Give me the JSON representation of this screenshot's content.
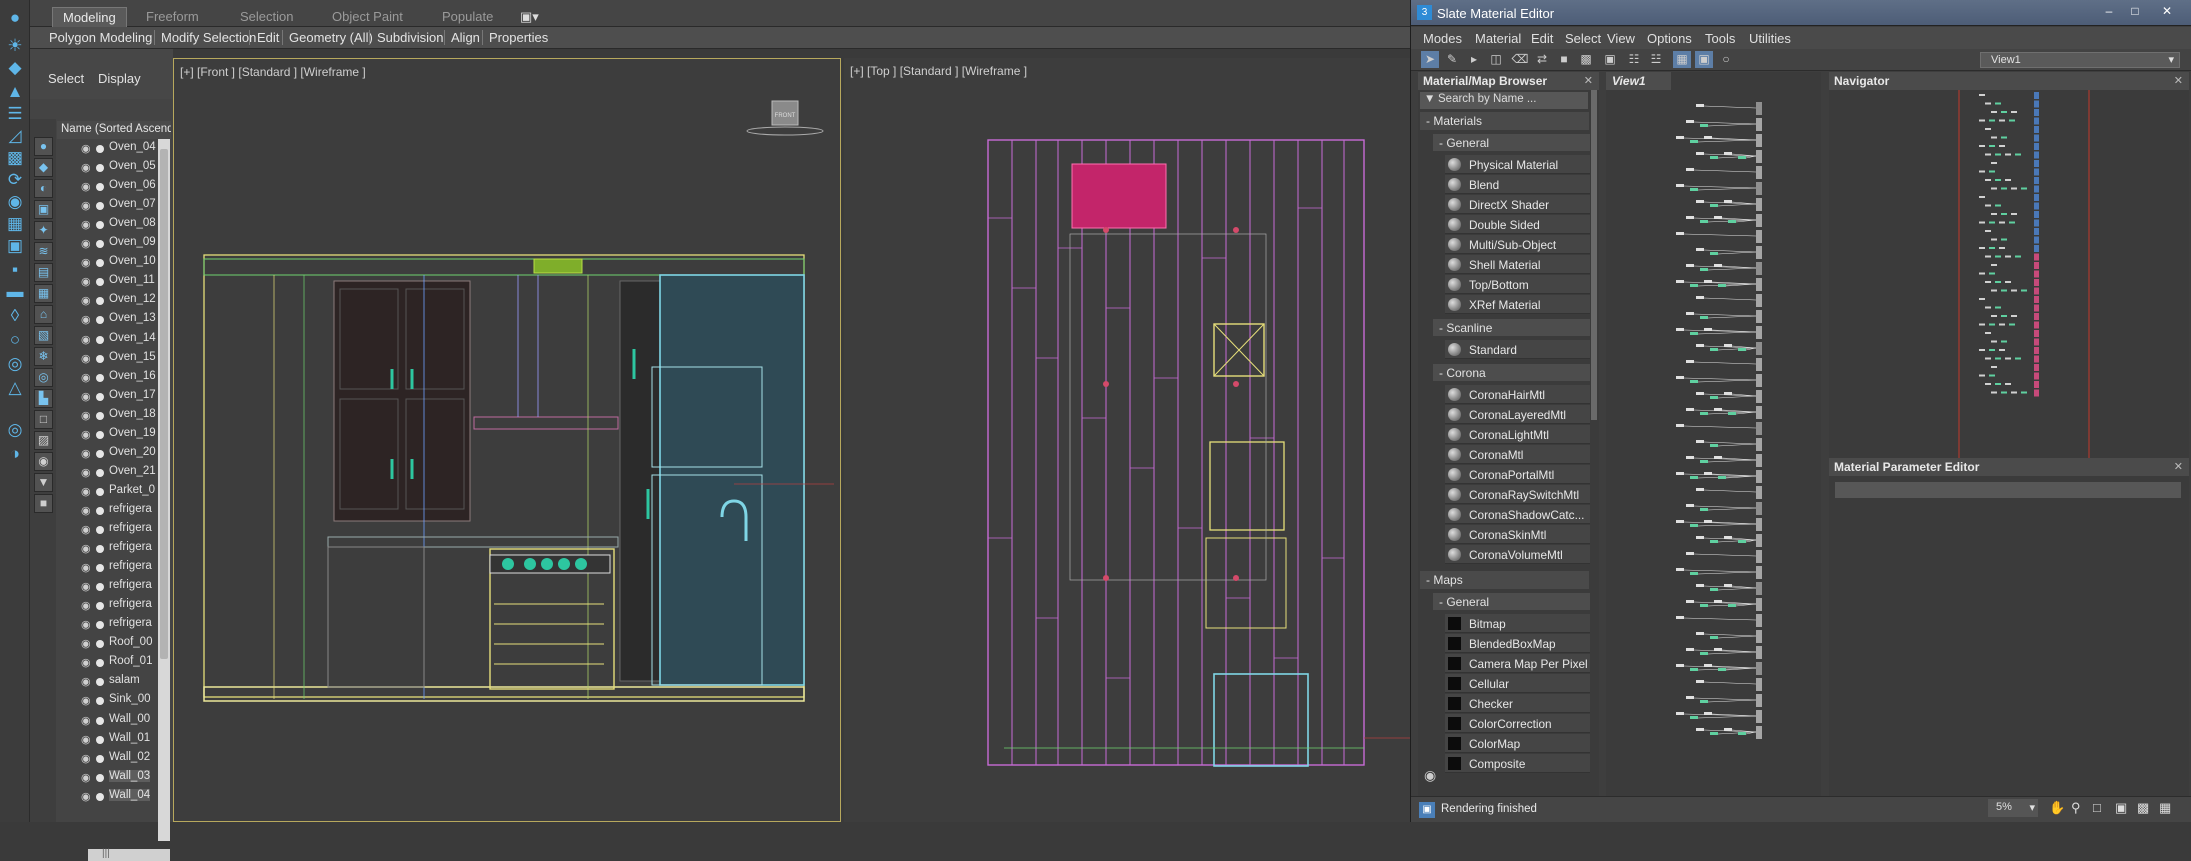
{
  "ribbon": {
    "tabs": [
      "Modeling",
      "Freeform",
      "Selection",
      "Object Paint",
      "Populate"
    ],
    "active_tab": "Modeling",
    "panel_items": [
      "Polygon Modeling",
      "Modify Selection",
      "Edit",
      "Geometry (All)",
      "Subdivision",
      "Align",
      "Properties"
    ]
  },
  "explorer": {
    "menu": [
      "Select",
      "Display"
    ],
    "column_header": "Name (Sorted Ascendin",
    "rows": [
      "Oven_04",
      "Oven_05",
      "Oven_06",
      "Oven_07",
      "Oven_08",
      "Oven_09",
      "Oven_10",
      "Oven_11",
      "Oven_12",
      "Oven_13",
      "Oven_14",
      "Oven_15",
      "Oven_16",
      "Oven_17",
      "Oven_18",
      "Oven_19",
      "Oven_20",
      "Oven_21",
      "Parket_0",
      "refrigera",
      "refrigera",
      "refrigera",
      "refrigera",
      "refrigera",
      "refrigera",
      "refrigera",
      "Roof_00",
      "Roof_01",
      "salam",
      "Sink_00",
      "Wall_00",
      "Wall_01",
      "Wall_02",
      "Wall_03",
      "Wall_04"
    ],
    "selected_rows": [
      "Wall_03",
      "Wall_04"
    ],
    "hscroll_text": "|||"
  },
  "viewports": {
    "front_label": "[+] [Front ] [Standard ] [Wireframe ]",
    "top_label": "[+] [Top ] [Standard ] [Wireframe ]",
    "viewcube_label": "FRONT"
  },
  "slate": {
    "title": "Slate Material Editor",
    "window_buttons": [
      "–",
      "□",
      "✕"
    ],
    "menu": [
      "Modes",
      "Material",
      "Edit",
      "Select",
      "View",
      "Options",
      "Tools",
      "Utilities"
    ],
    "view_dropdown": "View1",
    "browser": {
      "title": "Material/Map Browser",
      "search_placeholder": "Search by Name ...",
      "materials_group": "Materials",
      "general_label": "General",
      "general_items": [
        "Physical Material",
        "Blend",
        "DirectX Shader",
        "Double Sided",
        "Multi/Sub-Object",
        "Shell Material",
        "Top/Bottom",
        "XRef Material"
      ],
      "scanline_label": "Scanline",
      "scanline_items": [
        "Standard"
      ],
      "corona_label": "Corona",
      "corona_items": [
        "CoronaHairMtl",
        "CoronaLayeredMtl",
        "CoronaLightMtl",
        "CoronaMtl",
        "CoronaPortalMtl",
        "CoronaRaySwitchMtl",
        "CoronaShadowCatc...",
        "CoronaSkinMtl",
        "CoronaVolumeMtl"
      ],
      "maps_group": "Maps",
      "maps_general_label": "General",
      "map_items": [
        "Bitmap",
        "BlendedBoxMap",
        "Camera Map Per Pixel",
        "Cellular",
        "Checker",
        "ColorCorrection",
        "ColorMap",
        "Composite"
      ]
    },
    "view_tab": "View1",
    "navigator_title": "Navigator",
    "mpe_title": "Material Parameter Editor",
    "status_text": "Rendering finished",
    "zoom_value": "5%"
  },
  "colors": {
    "accent": "#5fb6e8",
    "wire_pink": "#c76bd6",
    "wire_yellow": "#e6df7a",
    "wire_cyan": "#7fd6e6"
  }
}
